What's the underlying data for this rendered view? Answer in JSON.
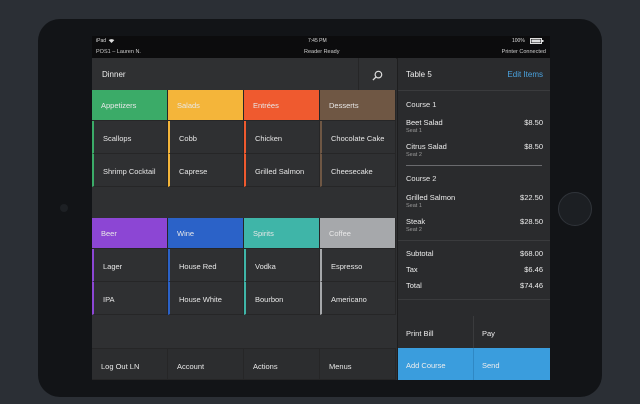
{
  "status": {
    "device": "iPad",
    "time": "7:45 PM",
    "battery": "100%"
  },
  "info": {
    "register": "POS1 – Lauren N.",
    "reader": "Reader Ready",
    "printer": "Printer Connected"
  },
  "menu": {
    "title": "Dinner",
    "top_groups": [
      {
        "label": "Appetizers",
        "color": "#3bab68",
        "items": [
          "Scallops",
          "Shrimp Cocktail"
        ]
      },
      {
        "label": "Salads",
        "color": "#f4b53a",
        "items": [
          "Cobb",
          "Caprese"
        ]
      },
      {
        "label": "Entrées",
        "color": "#ef5a2f",
        "items": [
          "Chicken",
          "Grilled Salmon"
        ]
      },
      {
        "label": "Desserts",
        "color": "#6f5744",
        "items": [
          "Chocolate Cake",
          "Cheesecake"
        ]
      }
    ],
    "bottom_groups": [
      {
        "label": "Beer",
        "color": "#8c46d4",
        "items": [
          "Lager",
          "IPA"
        ]
      },
      {
        "label": "Wine",
        "color": "#2b62c8",
        "items": [
          "House Red",
          "House White"
        ]
      },
      {
        "label": "Spirits",
        "color": "#3fb5a8",
        "items": [
          "Vodka",
          "Bourbon"
        ]
      },
      {
        "label": "Coffee",
        "color": "#a6a8ab",
        "items": [
          "Espresso",
          "Americano"
        ]
      }
    ],
    "footer": [
      "Log Out LN",
      "Account",
      "Actions",
      "Menus"
    ]
  },
  "ticket": {
    "title": "Table 5",
    "edit": "Edit Items",
    "courses": [
      {
        "label": "Course 1",
        "lines": [
          {
            "name": "Beet Salad",
            "seat": "Seat 1",
            "price": "$8.50"
          },
          {
            "name": "Citrus Salad",
            "seat": "Seat 2",
            "price": "$8.50"
          }
        ]
      },
      {
        "label": "Course 2",
        "lines": [
          {
            "name": "Grilled Salmon",
            "seat": "Seat 1",
            "price": "$22.50"
          },
          {
            "name": "Steak",
            "seat": "Seat 2",
            "price": "$28.50"
          }
        ]
      }
    ],
    "subtotal_label": "Subtotal",
    "subtotal": "$68.00",
    "tax_label": "Tax",
    "tax": "$6.46",
    "total_label": "Total",
    "total": "$74.46",
    "actions": [
      "Print Bill",
      "Pay",
      "Add Course",
      "Send"
    ],
    "accent": "#3a9ddd"
  }
}
